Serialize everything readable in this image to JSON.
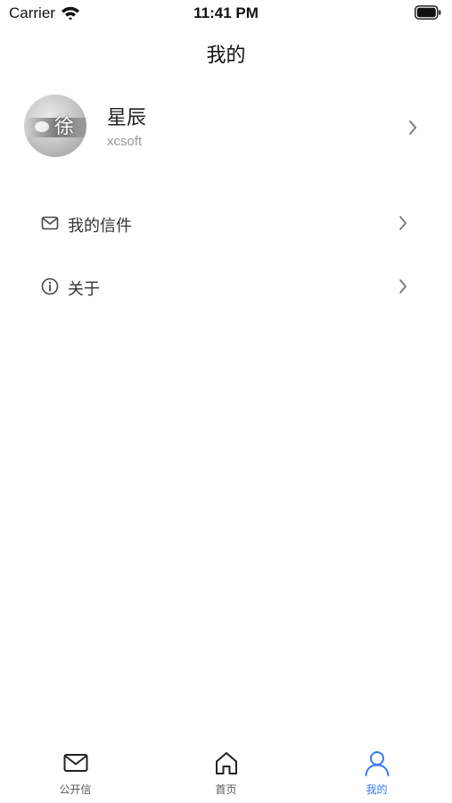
{
  "status_bar": {
    "carrier": "Carrier",
    "time": "11:41 PM"
  },
  "nav": {
    "title": "我的"
  },
  "profile": {
    "name": "星辰",
    "account": "xcsoft",
    "avatar_glyph": "徐"
  },
  "menu": [
    {
      "label": "我的信件",
      "icon": "mail-icon"
    },
    {
      "label": "关于",
      "icon": "info-icon"
    }
  ],
  "tab_bar": {
    "active_color": "#3478f6",
    "inactive_color": "#222222",
    "tabs": [
      {
        "label": "公开信",
        "icon": "mail-icon",
        "active": false
      },
      {
        "label": "首页",
        "icon": "home-icon",
        "active": false
      },
      {
        "label": "我的",
        "icon": "person-icon",
        "active": true
      }
    ]
  }
}
